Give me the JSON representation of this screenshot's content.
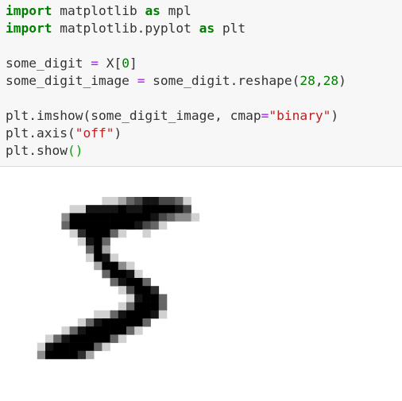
{
  "notebook": {
    "input_cell": {
      "lines": [
        [
          {
            "t": "import",
            "c": "kw"
          },
          {
            "t": " matplotlib ",
            "c": ""
          },
          {
            "t": "as",
            "c": "kw"
          },
          {
            "t": " mpl",
            "c": ""
          }
        ],
        [
          {
            "t": "import",
            "c": "kw"
          },
          {
            "t": " matplotlib.pyplot ",
            "c": ""
          },
          {
            "t": "as",
            "c": "kw"
          },
          {
            "t": " plt",
            "c": ""
          }
        ],
        [],
        [
          {
            "t": "some_digit ",
            "c": ""
          },
          {
            "t": "=",
            "c": "op"
          },
          {
            "t": " X[",
            "c": ""
          },
          {
            "t": "0",
            "c": "num"
          },
          {
            "t": "]",
            "c": ""
          }
        ],
        [
          {
            "t": "some_digit_image ",
            "c": ""
          },
          {
            "t": "=",
            "c": "op"
          },
          {
            "t": " some_digit.reshape(",
            "c": ""
          },
          {
            "t": "28",
            "c": "num"
          },
          {
            "t": ",",
            "c": ""
          },
          {
            "t": "28",
            "c": "num"
          },
          {
            "t": ")",
            "c": ""
          }
        ],
        [],
        [
          {
            "t": "plt.imshow(some_digit_image, cmap",
            "c": ""
          },
          {
            "t": "=",
            "c": "op"
          },
          {
            "t": "\"binary\"",
            "c": "str"
          },
          {
            "t": ")",
            "c": ""
          }
        ],
        [
          {
            "t": "plt.axis(",
            "c": ""
          },
          {
            "t": "\"off\"",
            "c": "str"
          },
          {
            "t": ")",
            "c": ""
          }
        ],
        [
          {
            "t": "plt.show",
            "c": ""
          },
          {
            "t": "()",
            "c": "par"
          }
        ]
      ]
    },
    "output_cell": {
      "image": {
        "cmap": "binary",
        "grid_size": 28,
        "pixels": [
          "                            ",
          "                            ",
          "                            ",
          "                            ",
          "                            ",
          "            ..:=+##++=.     ",
          "        ..####@##@@@@#+     ",
          "       -@@@@@@@@@@#+=--.    ",
          "       =@@@@@@@@#+=.        ",
          "        .*@@@=.  .          ",
          "         .#@=               ",
          "          =@:               ",
          "          .@#.              ",
          "           :@@-.            ",
          "            =@@#.           ",
          "             =#@@=          ",
          "              .+@@*         ",
          "               .#@@=        ",
          "              .=@@@=        ",
          "           ..=#@@@#.        ",
          "         .=#@@@@@=          ",
          "       .=#@@@@@=.           ",
          "     .=#@@@@@=.             ",
          "    .#@@@@@=.               ",
          "    -@@@@*:                 ",
          "                            ",
          "                            ",
          "                            "
        ]
      }
    }
  }
}
